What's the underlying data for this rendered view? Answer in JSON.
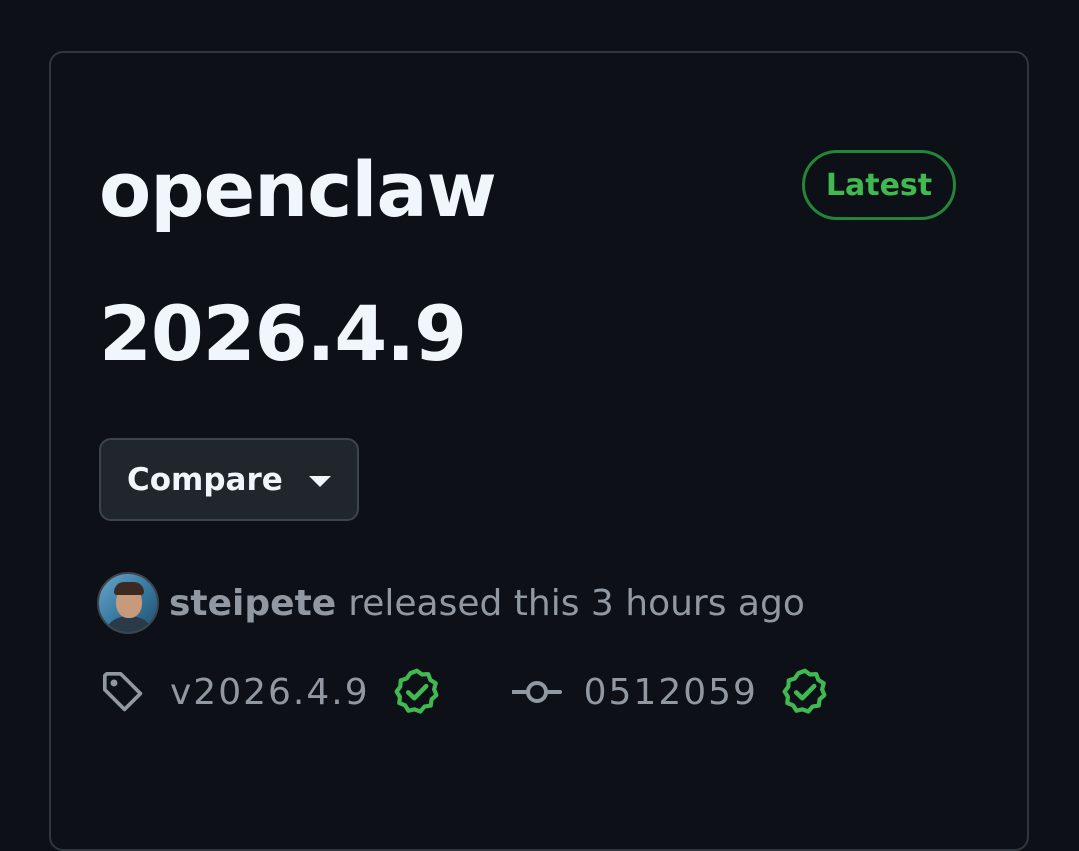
{
  "release": {
    "title_line1": "openclaw",
    "title_line2": "2026.4.9",
    "badge": "Latest"
  },
  "compare": {
    "label": "Compare"
  },
  "meta": {
    "author": "steipete",
    "text": "released this 3 hours ago"
  },
  "refs": {
    "tag": "v2026.4.9",
    "commit": "0512059"
  },
  "colors": {
    "background": "#0d1117",
    "border": "#30363d",
    "title": "#f0f6fc",
    "muted": "#9198a1",
    "success": "#3fb950",
    "success_border": "#238636",
    "button_bg": "#21262d"
  },
  "icons": {
    "tag": "tag-icon",
    "verified": "verified-check-icon",
    "commit": "git-commit-icon",
    "caret": "triangle-down-icon"
  }
}
